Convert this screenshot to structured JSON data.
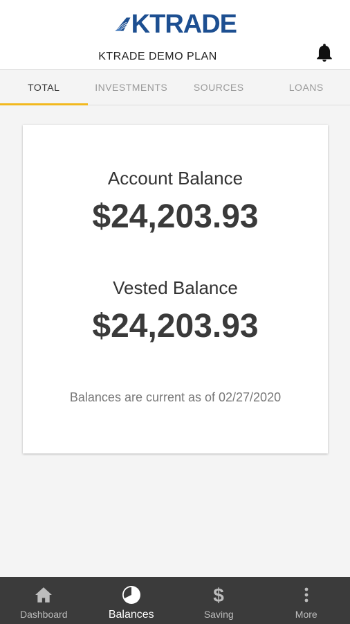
{
  "header": {
    "logo_text": "KTRADE",
    "plan_name": "KTRADE DEMO PLAN",
    "brand_color": "#1d4f91"
  },
  "tabs": [
    {
      "label": "TOTAL",
      "active": true
    },
    {
      "label": "INVESTMENTS",
      "active": false
    },
    {
      "label": "SOURCES",
      "active": false
    },
    {
      "label": "LOANS",
      "active": false
    }
  ],
  "tab_indicator_color": "#f2b81d",
  "balances": {
    "account_label": "Account Balance",
    "account_value": "$24,203.93",
    "vested_label": "Vested Balance",
    "vested_value": "$24,203.93",
    "as_of_text": "Balances are current as of 02/27/2020"
  },
  "bottom_nav": [
    {
      "label": "Dashboard",
      "icon": "home-icon",
      "active": false
    },
    {
      "label": "Balances",
      "icon": "pie-chart-icon",
      "active": true
    },
    {
      "label": "Saving",
      "icon": "dollar-icon",
      "active": false
    },
    {
      "label": "More",
      "icon": "more-vertical-icon",
      "active": false
    }
  ]
}
